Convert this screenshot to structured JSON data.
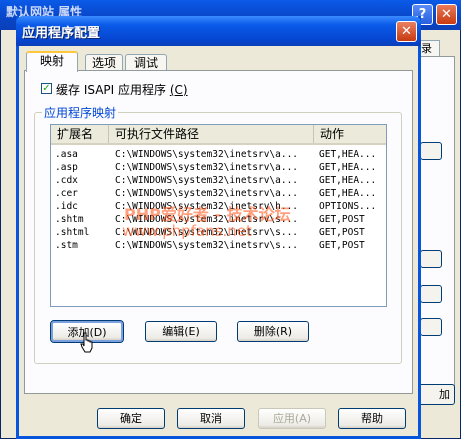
{
  "background_window": {
    "title": "默认网站 属性",
    "tab_fragment": "录",
    "apply_fragment": "加"
  },
  "dialog": {
    "title": "应用程序配置",
    "close_icon": "close-icon",
    "tabs": [
      {
        "label": "映射",
        "active": true
      },
      {
        "label": "选项",
        "active": false
      },
      {
        "label": "调试",
        "active": false
      }
    ],
    "cache_checkbox": {
      "label": "缓存 ISAPI 应用程序",
      "accel": "C",
      "checked": true
    },
    "group_label": "应用程序映射",
    "columns": [
      "扩展名",
      "可执行文件路径",
      "动作"
    ],
    "rows": [
      {
        "ext": ".asa",
        "path": "C:\\WINDOWS\\system32\\inetsrv\\a...",
        "verbs": "GET,HEA..."
      },
      {
        "ext": ".asp",
        "path": "C:\\WINDOWS\\system32\\inetsrv\\a...",
        "verbs": "GET,HEA..."
      },
      {
        "ext": ".cdx",
        "path": "C:\\WINDOWS\\system32\\inetsrv\\a...",
        "verbs": "GET,HEA..."
      },
      {
        "ext": ".cer",
        "path": "C:\\WINDOWS\\system32\\inetsrv\\a...",
        "verbs": "GET,HEA..."
      },
      {
        "ext": ".idc",
        "path": "C:\\WINDOWS\\system32\\inetsrv\\h...",
        "verbs": "OPTIONS..."
      },
      {
        "ext": ".shtm",
        "path": "C:\\WINDOWS\\system32\\inetsrv\\s...",
        "verbs": "GET,POST"
      },
      {
        "ext": ".shtml",
        "path": "C:\\WINDOWS\\system32\\inetsrv\\s...",
        "verbs": "GET,POST"
      },
      {
        "ext": ".stm",
        "path": "C:\\WINDOWS\\system32\\inetsrv\\s...",
        "verbs": "GET,POST"
      }
    ],
    "buttons": {
      "add": "添加(D)",
      "edit": "编辑(E)",
      "remove": "删除(R)"
    },
    "footer": {
      "ok": "确定",
      "cancel": "取消",
      "apply": "应用(A)",
      "help": "帮助"
    },
    "watermark": {
      "line1": "PHP爱好者 - 技术论坛",
      "line2": "www.phpfans.net"
    }
  }
}
